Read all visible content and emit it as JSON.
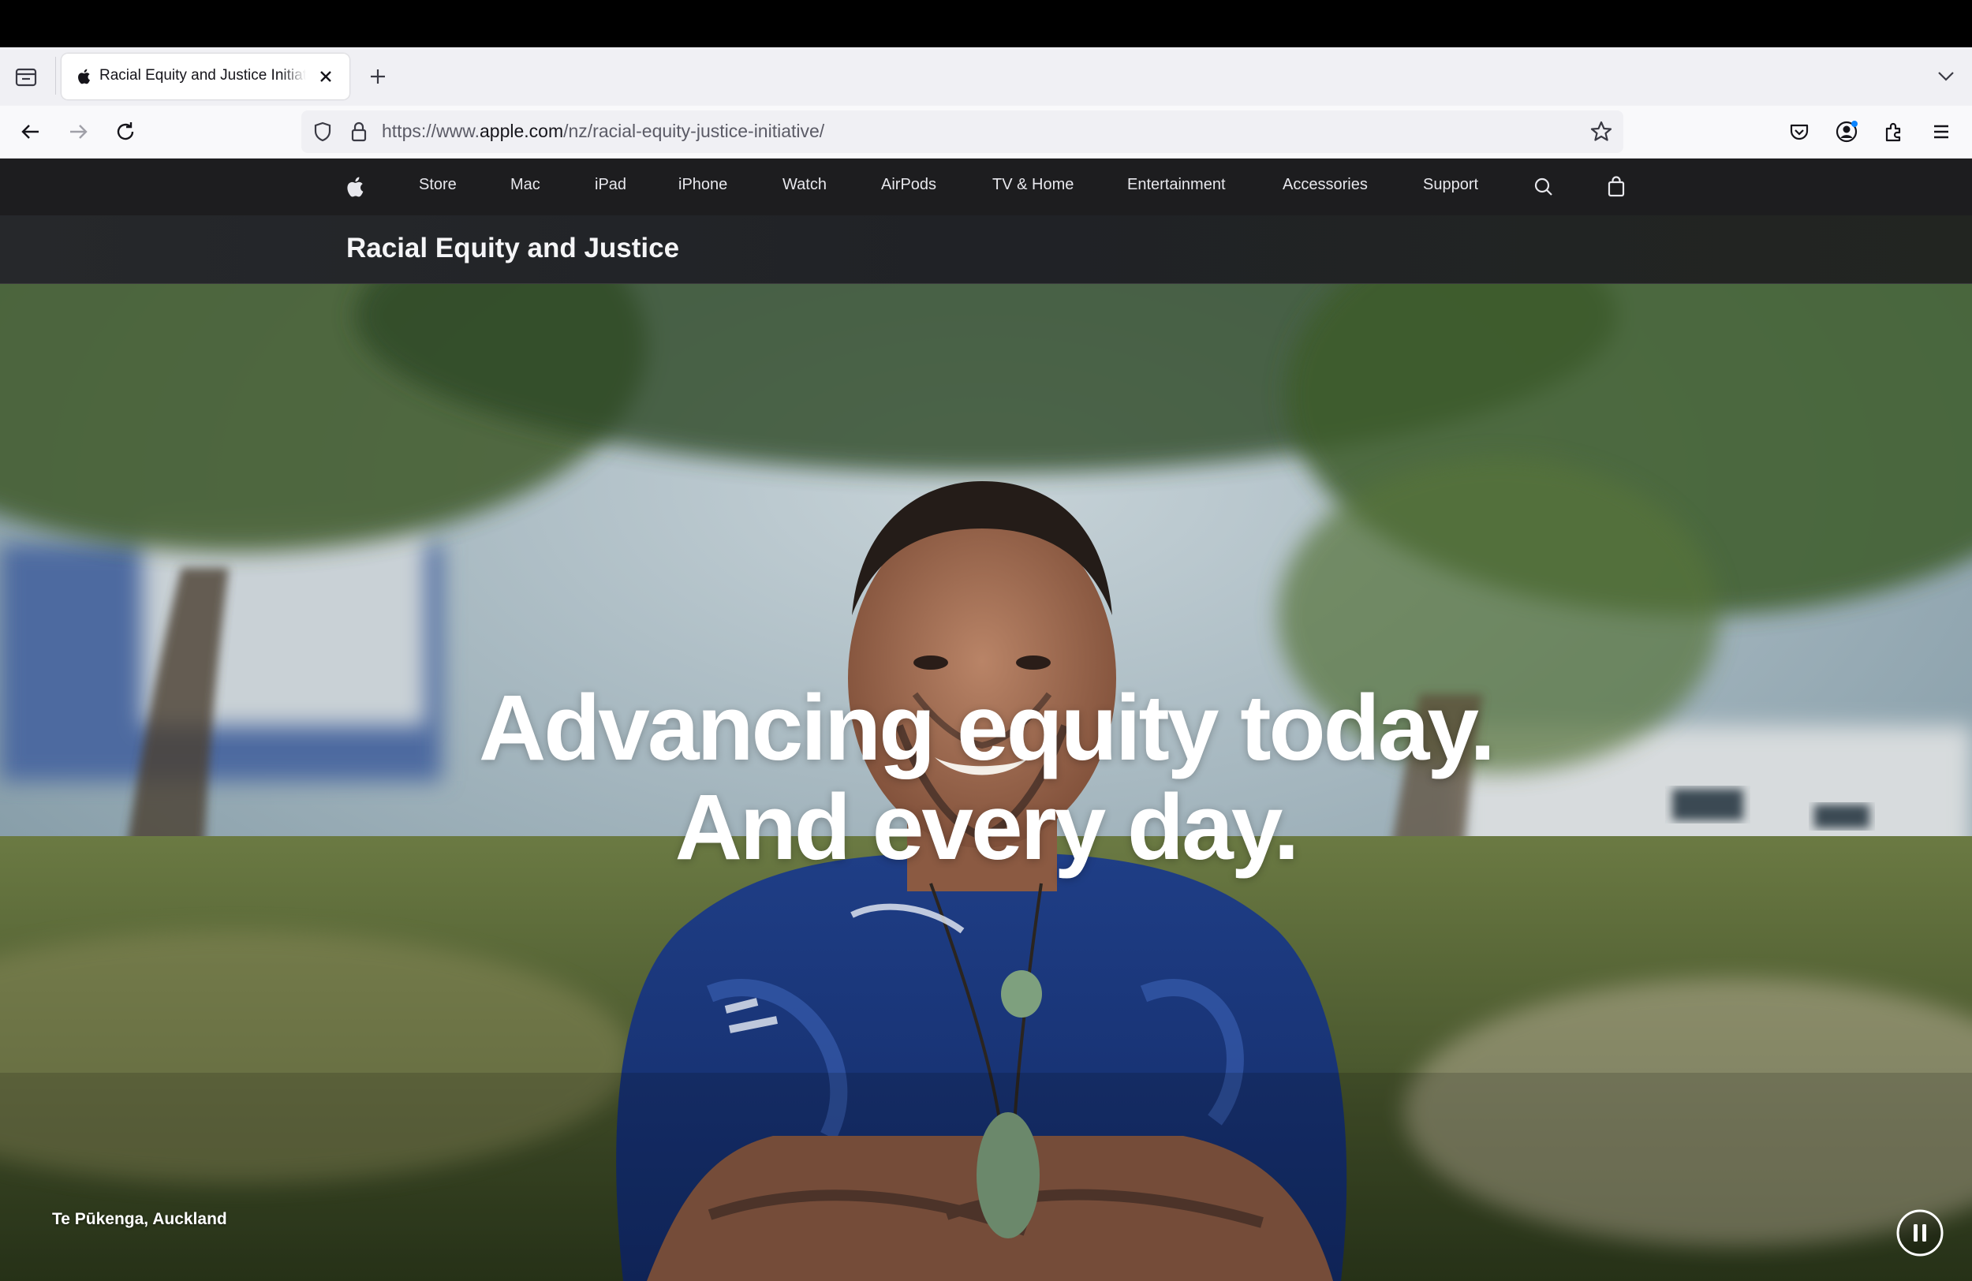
{
  "browser": {
    "tab": {
      "title": "Racial Equity and Justice Initiati",
      "favicon": "apple-logo-icon"
    },
    "url": {
      "prefix": "https://www.",
      "domain": "apple.com",
      "path": "/nz/racial-equity-justice-initiative/"
    }
  },
  "global_nav": {
    "items": [
      "Store",
      "Mac",
      "iPad",
      "iPhone",
      "Watch",
      "AirPods",
      "TV & Home",
      "Entertainment",
      "Accessories",
      "Support"
    ]
  },
  "local_nav": {
    "title": "Racial Equity and Justice"
  },
  "hero": {
    "headline_line1": "Advancing equity today.",
    "headline_line2": "And every day.",
    "caption": "Te Pūkenga, Auckland"
  },
  "colors": {
    "nav_background": "#1d1d1f",
    "nav_text": "#e8e8ed",
    "headline": "#ffffff"
  }
}
